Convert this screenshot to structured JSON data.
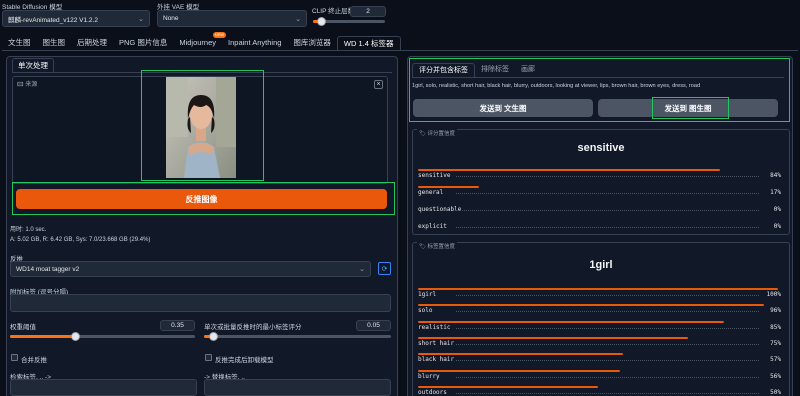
{
  "top": {
    "sd_model_label": "Stable Diffusion 模型",
    "sd_model_value": "麒麟-revAnimated_v122 V1.2.2",
    "vae_label": "外挂 VAE 模型",
    "vae_value": "None",
    "clip_label": "CLIP 终止层数",
    "clip_value": "2",
    "clip_level": 0.1
  },
  "tabs": [
    "文生图",
    "图生图",
    "后期处理",
    "PNG 图片信息",
    "Midjourney",
    "Inpaint Anything",
    "图库浏览器",
    "WD 1.4 标签器"
  ],
  "tab_badge": "NEW",
  "left": {
    "subtab": "单次处理",
    "source_label": "来源",
    "interrogate_btn": "反推图像",
    "time_text": "用时: 1.0 sec.",
    "vram_text": "A: 5.02 GB, R: 6.42 GB, Sys: 7.0/23.668 GB (29.4%)",
    "interrogator_label": "反推",
    "interrogator_value": "WD14 moat tagger v2",
    "additional_tags_label": "附加标签 (逗号分隔)",
    "threshold_label": "权重阈值",
    "threshold_value": "0.35",
    "threshold_level": 0.35,
    "batch_label": "单次或批量反推时的最小标签评分",
    "batch_value": "0.05",
    "batch_level": 0.05,
    "combine_label": "合并反推",
    "unload_label": "反推完成后卸载模型",
    "search_label": "检索标签, .. ->",
    "replace_label": "-> 替换标签, .."
  },
  "right": {
    "tag_tabs": [
      "评分并包含标签",
      "排除标签",
      "画廊"
    ],
    "tags_text": "1girl, solo, realistic, short hair, black hair, blurry, outdoors, looking at viewer, lips, brown hair, brown eyes, dress, road",
    "send_txt2img": "发送到 文生图",
    "send_img2img": "发送到 图生图",
    "rating_label": "评分置信度",
    "rating_top": "sensitive",
    "ratings": [
      {
        "name": "sensitive",
        "pct": "84%",
        "v": 0.84
      },
      {
        "name": "general",
        "pct": "17%",
        "v": 0.17
      },
      {
        "name": "questionable",
        "pct": "0%",
        "v": 0.0
      },
      {
        "name": "explicit",
        "pct": "0%",
        "v": 0.0
      }
    ],
    "tags_label": "标签置信度",
    "tags_top": "1girl",
    "tags": [
      {
        "name": "1girl",
        "pct": "100%",
        "v": 1.0
      },
      {
        "name": "solo",
        "pct": "96%",
        "v": 0.96
      },
      {
        "name": "realistic",
        "pct": "85%",
        "v": 0.85
      },
      {
        "name": "short hair",
        "pct": "75%",
        "v": 0.75
      },
      {
        "name": "black hair",
        "pct": "57%",
        "v": 0.57
      },
      {
        "name": "blurry",
        "pct": "56%",
        "v": 0.56
      },
      {
        "name": "outdoors",
        "pct": "50%",
        "v": 0.5
      }
    ]
  },
  "colors": {
    "accent": "#f97316",
    "highlight": "#22c55e",
    "bg": "#0b0f19",
    "panel": "#111827"
  }
}
